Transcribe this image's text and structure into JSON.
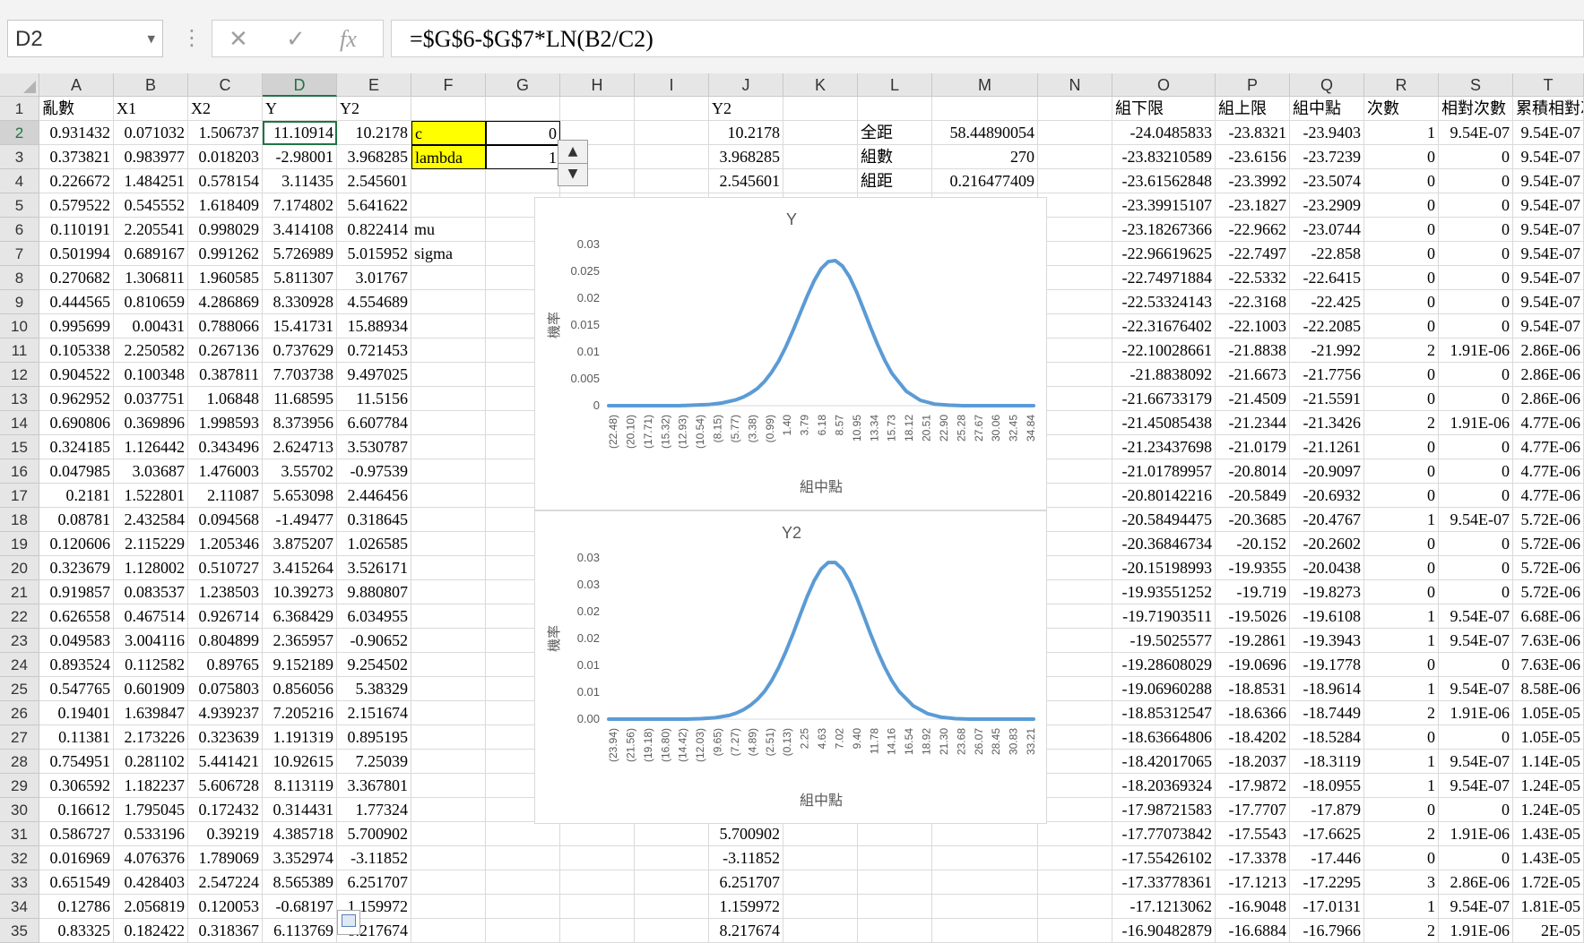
{
  "formula_bar": {
    "name_box": "D2",
    "cancel_icon": "✕",
    "enter_icon": "✓",
    "fx_icon": "fx",
    "formula": "=$G$6-$G$7*LN(B2/C2)"
  },
  "columns": [
    "A",
    "B",
    "C",
    "D",
    "E",
    "F",
    "G",
    "H",
    "I",
    "J",
    "K",
    "L",
    "M",
    "N",
    "O",
    "P",
    "Q",
    "R",
    "S",
    "T"
  ],
  "rows": [
    {
      "A": "亂數",
      "B": "X1",
      "C": "X2",
      "D": "Y",
      "E": "Y2",
      "J": "Y2",
      "O": "組下限",
      "P": "組上限",
      "Q": "組中點",
      "R": "次數",
      "S": "相對次數",
      "T": "累積相對次"
    },
    {
      "A": "0.931432",
      "B": "0.071032",
      "C": "1.506737",
      "D": "11.10914",
      "E": "10.2178",
      "F": "c",
      "G": "0",
      "J": "10.2178",
      "L": "全距",
      "M": "58.44890054",
      "O": "-24.0485833",
      "P": "-23.8321",
      "Q": "-23.9403",
      "R": "1",
      "S": "9.54E-07",
      "T": "9.54E-07"
    },
    {
      "A": "0.373821",
      "B": "0.983977",
      "C": "0.018203",
      "D": "-2.98001",
      "E": "3.968285",
      "F": "lambda",
      "G": "1",
      "J": "3.968285",
      "L": "組數",
      "M": "270",
      "O": "-23.83210589",
      "P": "-23.6156",
      "Q": "-23.7239",
      "R": "0",
      "S": "0",
      "T": "9.54E-07"
    },
    {
      "A": "0.226672",
      "B": "1.484251",
      "C": "0.578154",
      "D": "3.11435",
      "E": "2.545601",
      "J": "2.545601",
      "L": "組距",
      "M": "0.216477409",
      "O": "-23.61562848",
      "P": "-23.3992",
      "Q": "-23.5074",
      "R": "0",
      "S": "0",
      "T": "9.54E-07"
    },
    {
      "A": "0.579522",
      "B": "0.545552",
      "C": "1.618409",
      "D": "7.174802",
      "E": "5.641622",
      "O": "-23.39915107",
      "P": "-23.1827",
      "Q": "-23.2909",
      "R": "0",
      "S": "0",
      "T": "9.54E-07"
    },
    {
      "A": "0.110191",
      "B": "2.205541",
      "C": "0.998029",
      "D": "3.414108",
      "E": "0.822414",
      "F": "mu",
      "O": "-23.18267366",
      "P": "-22.9662",
      "Q": "-23.0744",
      "R": "0",
      "S": "0",
      "T": "9.54E-07"
    },
    {
      "A": "0.501994",
      "B": "0.689167",
      "C": "0.991262",
      "D": "5.726989",
      "E": "5.015952",
      "F": "sigma",
      "O": "-22.96619625",
      "P": "-22.7497",
      "Q": "-22.858",
      "R": "0",
      "S": "0",
      "T": "9.54E-07"
    },
    {
      "A": "0.270682",
      "B": "1.306811",
      "C": "1.960585",
      "D": "5.811307",
      "E": "3.01767",
      "O": "-22.74971884",
      "P": "-22.5332",
      "Q": "-22.6415",
      "R": "0",
      "S": "0",
      "T": "9.54E-07"
    },
    {
      "A": "0.444565",
      "B": "0.810659",
      "C": "4.286869",
      "D": "8.330928",
      "E": "4.554689",
      "O": "-22.53324143",
      "P": "-22.3168",
      "Q": "-22.425",
      "R": "0",
      "S": "0",
      "T": "9.54E-07"
    },
    {
      "A": "0.995699",
      "B": "0.00431",
      "C": "0.788066",
      "D": "15.41731",
      "E": "15.88934",
      "O": "-22.31676402",
      "P": "-22.1003",
      "Q": "-22.2085",
      "R": "0",
      "S": "0",
      "T": "9.54E-07"
    },
    {
      "A": "0.105338",
      "B": "2.250582",
      "C": "0.267136",
      "D": "0.737629",
      "E": "0.721453",
      "O": "-22.10028661",
      "P": "-21.8838",
      "Q": "-21.992",
      "R": "2",
      "S": "1.91E-06",
      "T": "2.86E-06"
    },
    {
      "A": "0.904522",
      "B": "0.100348",
      "C": "0.387811",
      "D": "7.703738",
      "E": "9.497025",
      "O": "-21.8838092",
      "P": "-21.6673",
      "Q": "-21.7756",
      "R": "0",
      "S": "0",
      "T": "2.86E-06"
    },
    {
      "A": "0.962952",
      "B": "0.037751",
      "C": "1.06848",
      "D": "11.68595",
      "E": "11.5156",
      "O": "-21.66733179",
      "P": "-21.4509",
      "Q": "-21.5591",
      "R": "0",
      "S": "0",
      "T": "2.86E-06"
    },
    {
      "A": "0.690806",
      "B": "0.369896",
      "C": "1.998593",
      "D": "8.373956",
      "E": "6.607784",
      "O": "-21.45085438",
      "P": "-21.2344",
      "Q": "-21.3426",
      "R": "2",
      "S": "1.91E-06",
      "T": "4.77E-06"
    },
    {
      "A": "0.324185",
      "B": "1.126442",
      "C": "0.343496",
      "D": "2.624713",
      "E": "3.530787",
      "O": "-21.23437698",
      "P": "-21.0179",
      "Q": "-21.1261",
      "R": "0",
      "S": "0",
      "T": "4.77E-06"
    },
    {
      "A": "0.047985",
      "B": "3.03687",
      "C": "1.476003",
      "D": "3.55702",
      "E": "-0.97539",
      "O": "-21.01789957",
      "P": "-20.8014",
      "Q": "-20.9097",
      "R": "0",
      "S": "0",
      "T": "4.77E-06"
    },
    {
      "A": "0.2181",
      "B": "1.522801",
      "C": "2.11087",
      "D": "5.653098",
      "E": "2.446456",
      "O": "-20.80142216",
      "P": "-20.5849",
      "Q": "-20.6932",
      "R": "0",
      "S": "0",
      "T": "4.77E-06"
    },
    {
      "A": "0.08781",
      "B": "2.432584",
      "C": "0.094568",
      "D": "-1.49477",
      "E": "0.318645",
      "O": "-20.58494475",
      "P": "-20.3685",
      "Q": "-20.4767",
      "R": "1",
      "S": "9.54E-07",
      "T": "5.72E-06"
    },
    {
      "A": "0.120606",
      "B": "2.115229",
      "C": "1.205346",
      "D": "3.875207",
      "E": "1.026585",
      "O": "-20.36846734",
      "P": "-20.152",
      "Q": "-20.2602",
      "R": "0",
      "S": "0",
      "T": "5.72E-06"
    },
    {
      "A": "0.323679",
      "B": "1.128002",
      "C": "0.510727",
      "D": "3.415264",
      "E": "3.526171",
      "O": "-20.15198993",
      "P": "-19.9355",
      "Q": "-20.0438",
      "R": "0",
      "S": "0",
      "T": "5.72E-06"
    },
    {
      "A": "0.919857",
      "B": "0.083537",
      "C": "1.238503",
      "D": "10.39273",
      "E": "9.880807",
      "O": "-19.93551252",
      "P": "-19.719",
      "Q": "-19.8273",
      "R": "0",
      "S": "0",
      "T": "5.72E-06"
    },
    {
      "A": "0.626558",
      "B": "0.467514",
      "C": "0.926714",
      "D": "6.368429",
      "E": "6.034955",
      "O": "-19.71903511",
      "P": "-19.5026",
      "Q": "-19.6108",
      "R": "1",
      "S": "9.54E-07",
      "T": "6.68E-06"
    },
    {
      "A": "0.049583",
      "B": "3.004116",
      "C": "0.804899",
      "D": "2.365957",
      "E": "-0.90652",
      "O": "-19.5025577",
      "P": "-19.2861",
      "Q": "-19.3943",
      "R": "1",
      "S": "9.54E-07",
      "T": "7.63E-06"
    },
    {
      "A": "0.893524",
      "B": "0.112582",
      "C": "0.89765",
      "D": "9.152189",
      "E": "9.254502",
      "O": "-19.28608029",
      "P": "-19.0696",
      "Q": "-19.1778",
      "R": "0",
      "S": "0",
      "T": "7.63E-06"
    },
    {
      "A": "0.547765",
      "B": "0.601909",
      "C": "0.075803",
      "D": "0.856056",
      "E": "5.38329",
      "O": "-19.06960288",
      "P": "-18.8531",
      "Q": "-18.9614",
      "R": "1",
      "S": "9.54E-07",
      "T": "8.58E-06"
    },
    {
      "A": "0.19401",
      "B": "1.639847",
      "C": "4.939237",
      "D": "7.205216",
      "E": "2.151674",
      "O": "-18.85312547",
      "P": "-18.6366",
      "Q": "-18.7449",
      "R": "2",
      "S": "1.91E-06",
      "T": "1.05E-05"
    },
    {
      "A": "0.11381",
      "B": "2.173226",
      "C": "0.323639",
      "D": "1.191319",
      "E": "0.895195",
      "O": "-18.63664806",
      "P": "-18.4202",
      "Q": "-18.5284",
      "R": "0",
      "S": "0",
      "T": "1.05E-05"
    },
    {
      "A": "0.754951",
      "B": "0.281102",
      "C": "5.441421",
      "D": "10.92615",
      "E": "7.25039",
      "O": "-18.42017065",
      "P": "-18.2037",
      "Q": "-18.3119",
      "R": "1",
      "S": "9.54E-07",
      "T": "1.14E-05"
    },
    {
      "A": "0.306592",
      "B": "1.182237",
      "C": "5.606728",
      "D": "8.113119",
      "E": "3.367801",
      "O": "-18.20369324",
      "P": "-17.9872",
      "Q": "-18.0955",
      "R": "1",
      "S": "9.54E-07",
      "T": "1.24E-05"
    },
    {
      "A": "0.16612",
      "B": "1.795045",
      "C": "0.172432",
      "D": "0.314431",
      "E": "1.77324",
      "O": "-17.98721583",
      "P": "-17.7707",
      "Q": "-17.879",
      "R": "0",
      "S": "0",
      "T": "1.24E-05"
    },
    {
      "A": "0.586727",
      "B": "0.533196",
      "C": "0.39219",
      "D": "4.385718",
      "E": "5.700902",
      "J": "5.700902",
      "O": "-17.77073842",
      "P": "-17.5543",
      "Q": "-17.6625",
      "R": "2",
      "S": "1.91E-06",
      "T": "1.43E-05"
    },
    {
      "A": "0.016969",
      "B": "4.076376",
      "C": "1.789069",
      "D": "3.352974",
      "E": "-3.11852",
      "J": "-3.11852",
      "O": "-17.55426102",
      "P": "-17.3378",
      "Q": "-17.446",
      "R": "0",
      "S": "0",
      "T": "1.43E-05"
    },
    {
      "A": "0.651549",
      "B": "0.428403",
      "C": "2.547224",
      "D": "8.565389",
      "E": "6.251707",
      "J": "6.251707",
      "O": "-17.33778361",
      "P": "-17.1213",
      "Q": "-17.2295",
      "R": "3",
      "S": "2.86E-06",
      "T": "1.72E-05"
    },
    {
      "A": "0.12786",
      "B": "2.056819",
      "C": "0.120053",
      "D": "-0.68197",
      "E": "1.159972",
      "J": "1.159972",
      "O": "-17.1213062",
      "P": "-16.9048",
      "Q": "-17.0131",
      "R": "1",
      "S": "9.54E-07",
      "T": "1.81E-05"
    },
    {
      "A": "0.83325",
      "B": "0.182422",
      "C": "0.318367",
      "D": "6.113769",
      "E": "8.217674",
      "J": "8.217674",
      "O": "-16.90482879",
      "P": "-16.6884",
      "Q": "-16.7966",
      "R": "2",
      "S": "1.91E-06",
      "T": "2E-05"
    }
  ],
  "colors": {
    "accent": "#217346",
    "series": "#5b9bd5",
    "highlight": "#ffff00"
  },
  "chart_data": [
    {
      "type": "line",
      "title": "Y",
      "xlabel": "組中點",
      "ylabel": "機率",
      "ylim": [
        0,
        0.03
      ],
      "yticks": [
        "0.03",
        "0.025",
        "0.02",
        "0.015",
        "0.01",
        "0.005",
        "0"
      ],
      "x_tick_labels": [
        "(22.48)",
        "(20.10)",
        "(17.71)",
        "(15.32)",
        "(12.93)",
        "(10.54)",
        "(8.15)",
        "(5.77)",
        "(3.38)",
        "(0.99)",
        "1.40",
        "3.79",
        "6.18",
        "8.57",
        "10.95",
        "13.34",
        "15.73",
        "18.12",
        "20.51",
        "22.90",
        "25.28",
        "27.67",
        "30.06",
        "32.45",
        "34.84"
      ],
      "x": [
        -24,
        -22,
        -20,
        -18,
        -16,
        -14,
        -12,
        -10,
        -8,
        -6,
        -5,
        -4,
        -3,
        -2,
        -1,
        0,
        1,
        2,
        3,
        4,
        5,
        6,
        7,
        8,
        9,
        10,
        11,
        12,
        13,
        14,
        15,
        16,
        18,
        20,
        22,
        24,
        26,
        28,
        30,
        32,
        34,
        36
      ],
      "values": [
        0,
        0,
        0,
        0,
        0,
        0,
        0.0001,
        0.0002,
        0.0005,
        0.0011,
        0.0016,
        0.0023,
        0.0032,
        0.0045,
        0.0062,
        0.0083,
        0.0109,
        0.0139,
        0.0171,
        0.0203,
        0.0232,
        0.0255,
        0.0268,
        0.027,
        0.026,
        0.024,
        0.0212,
        0.0179,
        0.0145,
        0.0113,
        0.0084,
        0.006,
        0.0027,
        0.001,
        0.0003,
        0.0001,
        0,
        0,
        0,
        0,
        0,
        0
      ]
    },
    {
      "type": "line",
      "title": "Y2",
      "xlabel": "組中點",
      "ylabel": "機率",
      "ylim": [
        0,
        0.035
      ],
      "yticks": [
        "0.03",
        "0.03",
        "0.02",
        "0.02",
        "0.01",
        "0.01",
        "0.00"
      ],
      "x_tick_labels": [
        "(23.94)",
        "(21.56)",
        "(19.18)",
        "(16.80)",
        "(14.42)",
        "(12.03)",
        "(9.65)",
        "(7.27)",
        "(4.89)",
        "(2.51)",
        "(0.13)",
        "2.25",
        "4.63",
        "7.02",
        "9.40",
        "11.78",
        "14.16",
        "16.54",
        "18.92",
        "21.30",
        "23.68",
        "26.07",
        "28.45",
        "30.83",
        "33.21"
      ],
      "x": [
        -25,
        -22,
        -20,
        -18,
        -16,
        -14,
        -12,
        -10,
        -8,
        -7,
        -6,
        -5,
        -4,
        -3,
        -2,
        -1,
        0,
        1,
        2,
        3,
        4,
        5,
        6,
        7,
        8,
        9,
        10,
        11,
        12,
        13,
        14,
        15,
        16,
        18,
        20,
        22,
        24,
        26,
        28,
        30,
        32,
        34,
        35
      ],
      "values": [
        0,
        0,
        0,
        0,
        0,
        0,
        0.0001,
        0.0003,
        0.0008,
        0.0013,
        0.002,
        0.003,
        0.0043,
        0.006,
        0.0083,
        0.0112,
        0.0146,
        0.0184,
        0.0225,
        0.0265,
        0.03,
        0.0326,
        0.034,
        0.034,
        0.0326,
        0.03,
        0.0265,
        0.0225,
        0.0184,
        0.0146,
        0.0112,
        0.0083,
        0.006,
        0.0029,
        0.0012,
        0.0004,
        0.0001,
        0,
        0,
        0,
        0,
        0,
        0
      ]
    }
  ]
}
